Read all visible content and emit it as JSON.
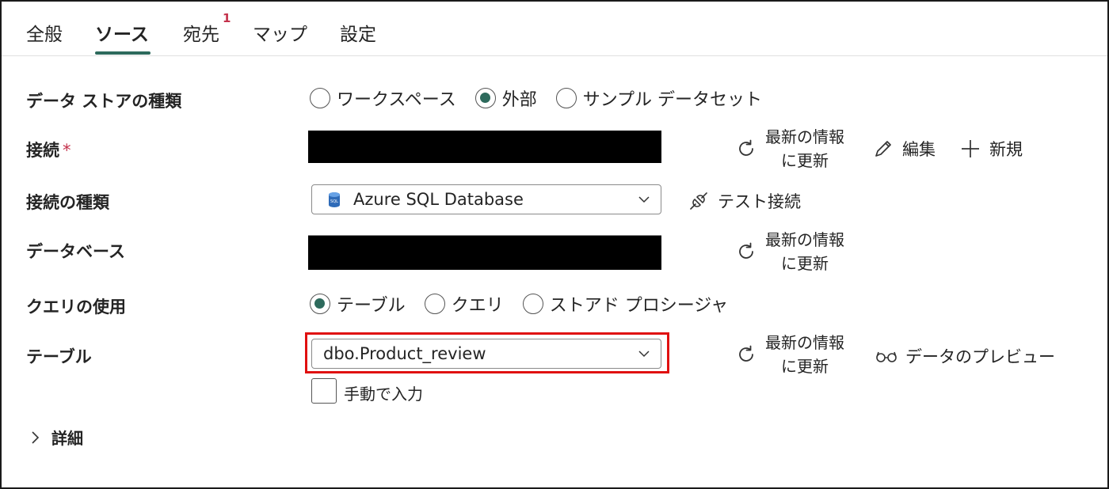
{
  "tabs": [
    {
      "label": "全般"
    },
    {
      "label": "ソース"
    },
    {
      "label": "宛先",
      "badge": "1"
    },
    {
      "label": "マップ"
    },
    {
      "label": "設定"
    }
  ],
  "store_type": {
    "label": "データ ストアの種類",
    "options": [
      "ワークスペース",
      "外部",
      "サンプル データセット"
    ],
    "selected": "外部"
  },
  "connection": {
    "label": "接続",
    "required_mark": "*",
    "refresh_line1": "最新の情報",
    "refresh_line2": "に更新",
    "edit_label": "編集",
    "new_label": "新規"
  },
  "connection_type": {
    "label": "接続の種類",
    "value": "Azure SQL Database",
    "icon_text": "SQL",
    "test_label": "テスト接続"
  },
  "database": {
    "label": "データベース",
    "refresh_line1": "最新の情報",
    "refresh_line2": "に更新"
  },
  "query_usage": {
    "label": "クエリの使用",
    "options": [
      "テーブル",
      "クエリ",
      "ストアド プロシージャ"
    ],
    "selected": "テーブル"
  },
  "table": {
    "label": "テーブル",
    "value": "dbo.Product_review",
    "refresh_line1": "最新の情報",
    "refresh_line2": "に更新",
    "preview_label": "データのプレビュー",
    "manual_entry_label": "手動で入力",
    "manual_entry_checked": false
  },
  "details": {
    "label": "詳細"
  },
  "colors": {
    "accent": "#2d6a5c",
    "highlight": "#e01010",
    "badge": "#c4314b"
  }
}
